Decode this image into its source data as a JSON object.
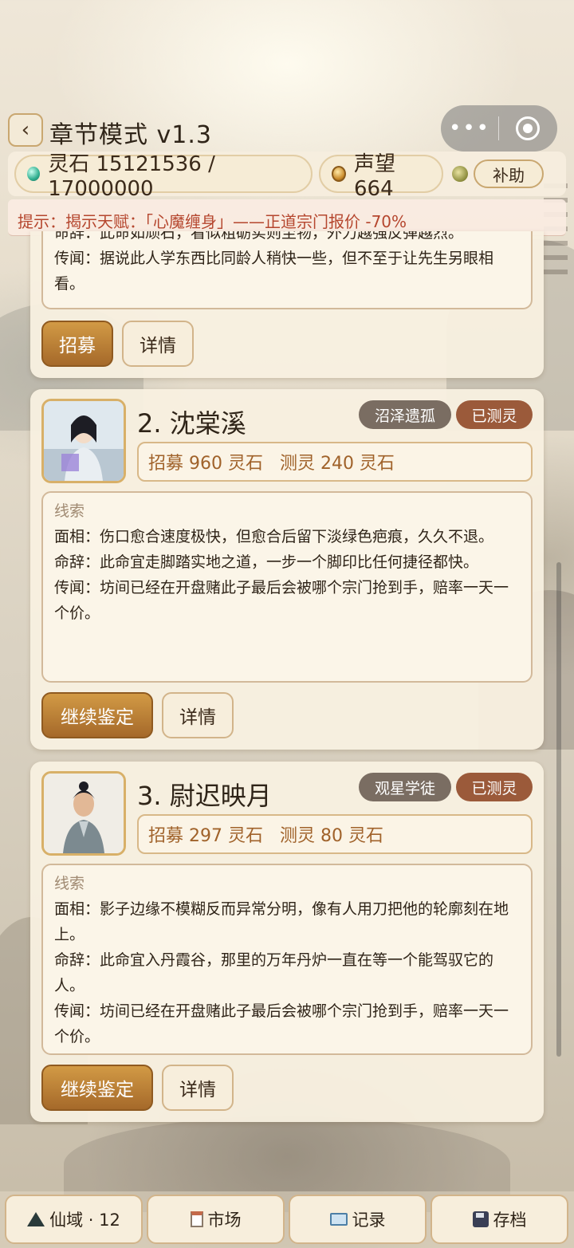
{
  "header": {
    "back_label": "‹",
    "title": "章节模式 v1.3",
    "capsule_more": "•••"
  },
  "resources": {
    "stone_label": "灵石 15121536 / 17000000",
    "reputation_label": "声望 664",
    "help_label": "补助"
  },
  "hint": "提示：揭示天赋：「心魔缠身」——正道宗门报价 -70%",
  "card1": {
    "partial_line": "命辞：此命如顽石，看似粗砺实则至物，外力越强反弹越烈。",
    "rumor": "传闻：据说此人学东西比同龄人稍快一些，但不至于让先生另眼相看。",
    "primary_btn": "招募",
    "detail_btn": "详情"
  },
  "candidates": [
    {
      "name": "2. 沈棠溪",
      "origin_tag": "沼泽遗孤",
      "status_tag": "已测灵",
      "cost": "招募 960 灵石   测灵 240 灵石",
      "clues_title": "线索",
      "face": "面相：伤口愈合速度极快，但愈合后留下淡绿色疤痕，久久不退。",
      "fate": "命辞：此命宜走脚踏实地之道，一步一个脚印比任何捷径都快。",
      "rumor": "传闻：坊间已经在开盘赌此子最后会被哪个宗门抢到手，赔率一天一个价。",
      "primary_btn": "继续鉴定",
      "detail_btn": "详情"
    },
    {
      "name": "3. 尉迟映月",
      "origin_tag": "观星学徒",
      "status_tag": "已测灵",
      "cost": "招募 297 灵石   测灵 80 灵石",
      "clues_title": "线索",
      "face": "面相：影子边缘不模糊反而异常分明，像有人用刀把他的轮廓刻在地上。",
      "fate": "命辞：此命宜入丹霞谷，那里的万年丹炉一直在等一个能驾驭它的人。",
      "rumor": "传闻：坊间已经在开盘赌此子最后会被哪个宗门抢到手，赔率一天一个价。",
      "primary_btn": "继续鉴定",
      "detail_btn": "详情"
    }
  ],
  "nav": {
    "realm": "仙域 · 12",
    "market": "市场",
    "records": "记录",
    "save": "存档"
  },
  "colors": {
    "accent": "#b07834",
    "hint_text": "#b5462e",
    "origin_tag": "#7a6d62",
    "status_tag": "#9b5a3a"
  }
}
